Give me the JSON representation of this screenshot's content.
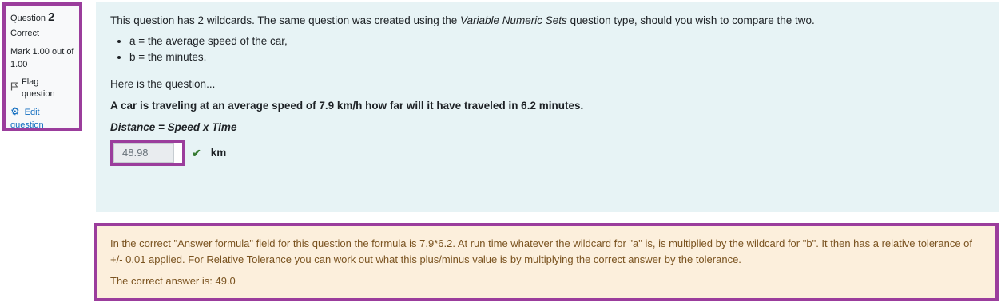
{
  "info": {
    "question_label": "Question",
    "question_number": "2",
    "state": "Correct",
    "mark": "Mark 1.00 out of 1.00",
    "flag_label": "Flag question",
    "edit_label": "Edit question"
  },
  "formulation": {
    "intro_start": "This question has 2 wildcards. The same question was created using the ",
    "intro_italic": "Variable Numeric Sets",
    "intro_end": " question type, should you wish to compare the two.",
    "bullets": [
      "a = the average speed of the car,",
      "b = the minutes."
    ],
    "here_is": "Here is the question...",
    "question_text": "A car is traveling at an average speed of 7.9 km/h how far will it have traveled in 6.2 minutes.",
    "formula_text": "Distance = Speed x Time",
    "answer_value": "48.98",
    "unit": "km"
  },
  "feedback": {
    "general": "In the correct \"Answer formula\" field for this question the formula is 7.9*6.2. At run time whatever the wildcard for \"a\" is, is multiplied by the wildcard for \"b\". It then has a relative tolerance of +/- 0.01 applied. For Relative Tolerance you can work out what this plus/minus value is by multiplying the correct answer by the tolerance.",
    "right_answer": "The correct answer is: 49.0"
  },
  "colors": {
    "highlight_border": "#9b3d9c",
    "formulation_bg": "#e7f3f5",
    "feedback_bg": "#fcefdc",
    "correct": "#357a32",
    "link": "#0f6cbf"
  },
  "icons": {
    "flag": "flag-icon",
    "edit": "gear-icon",
    "correct": "check-icon"
  }
}
